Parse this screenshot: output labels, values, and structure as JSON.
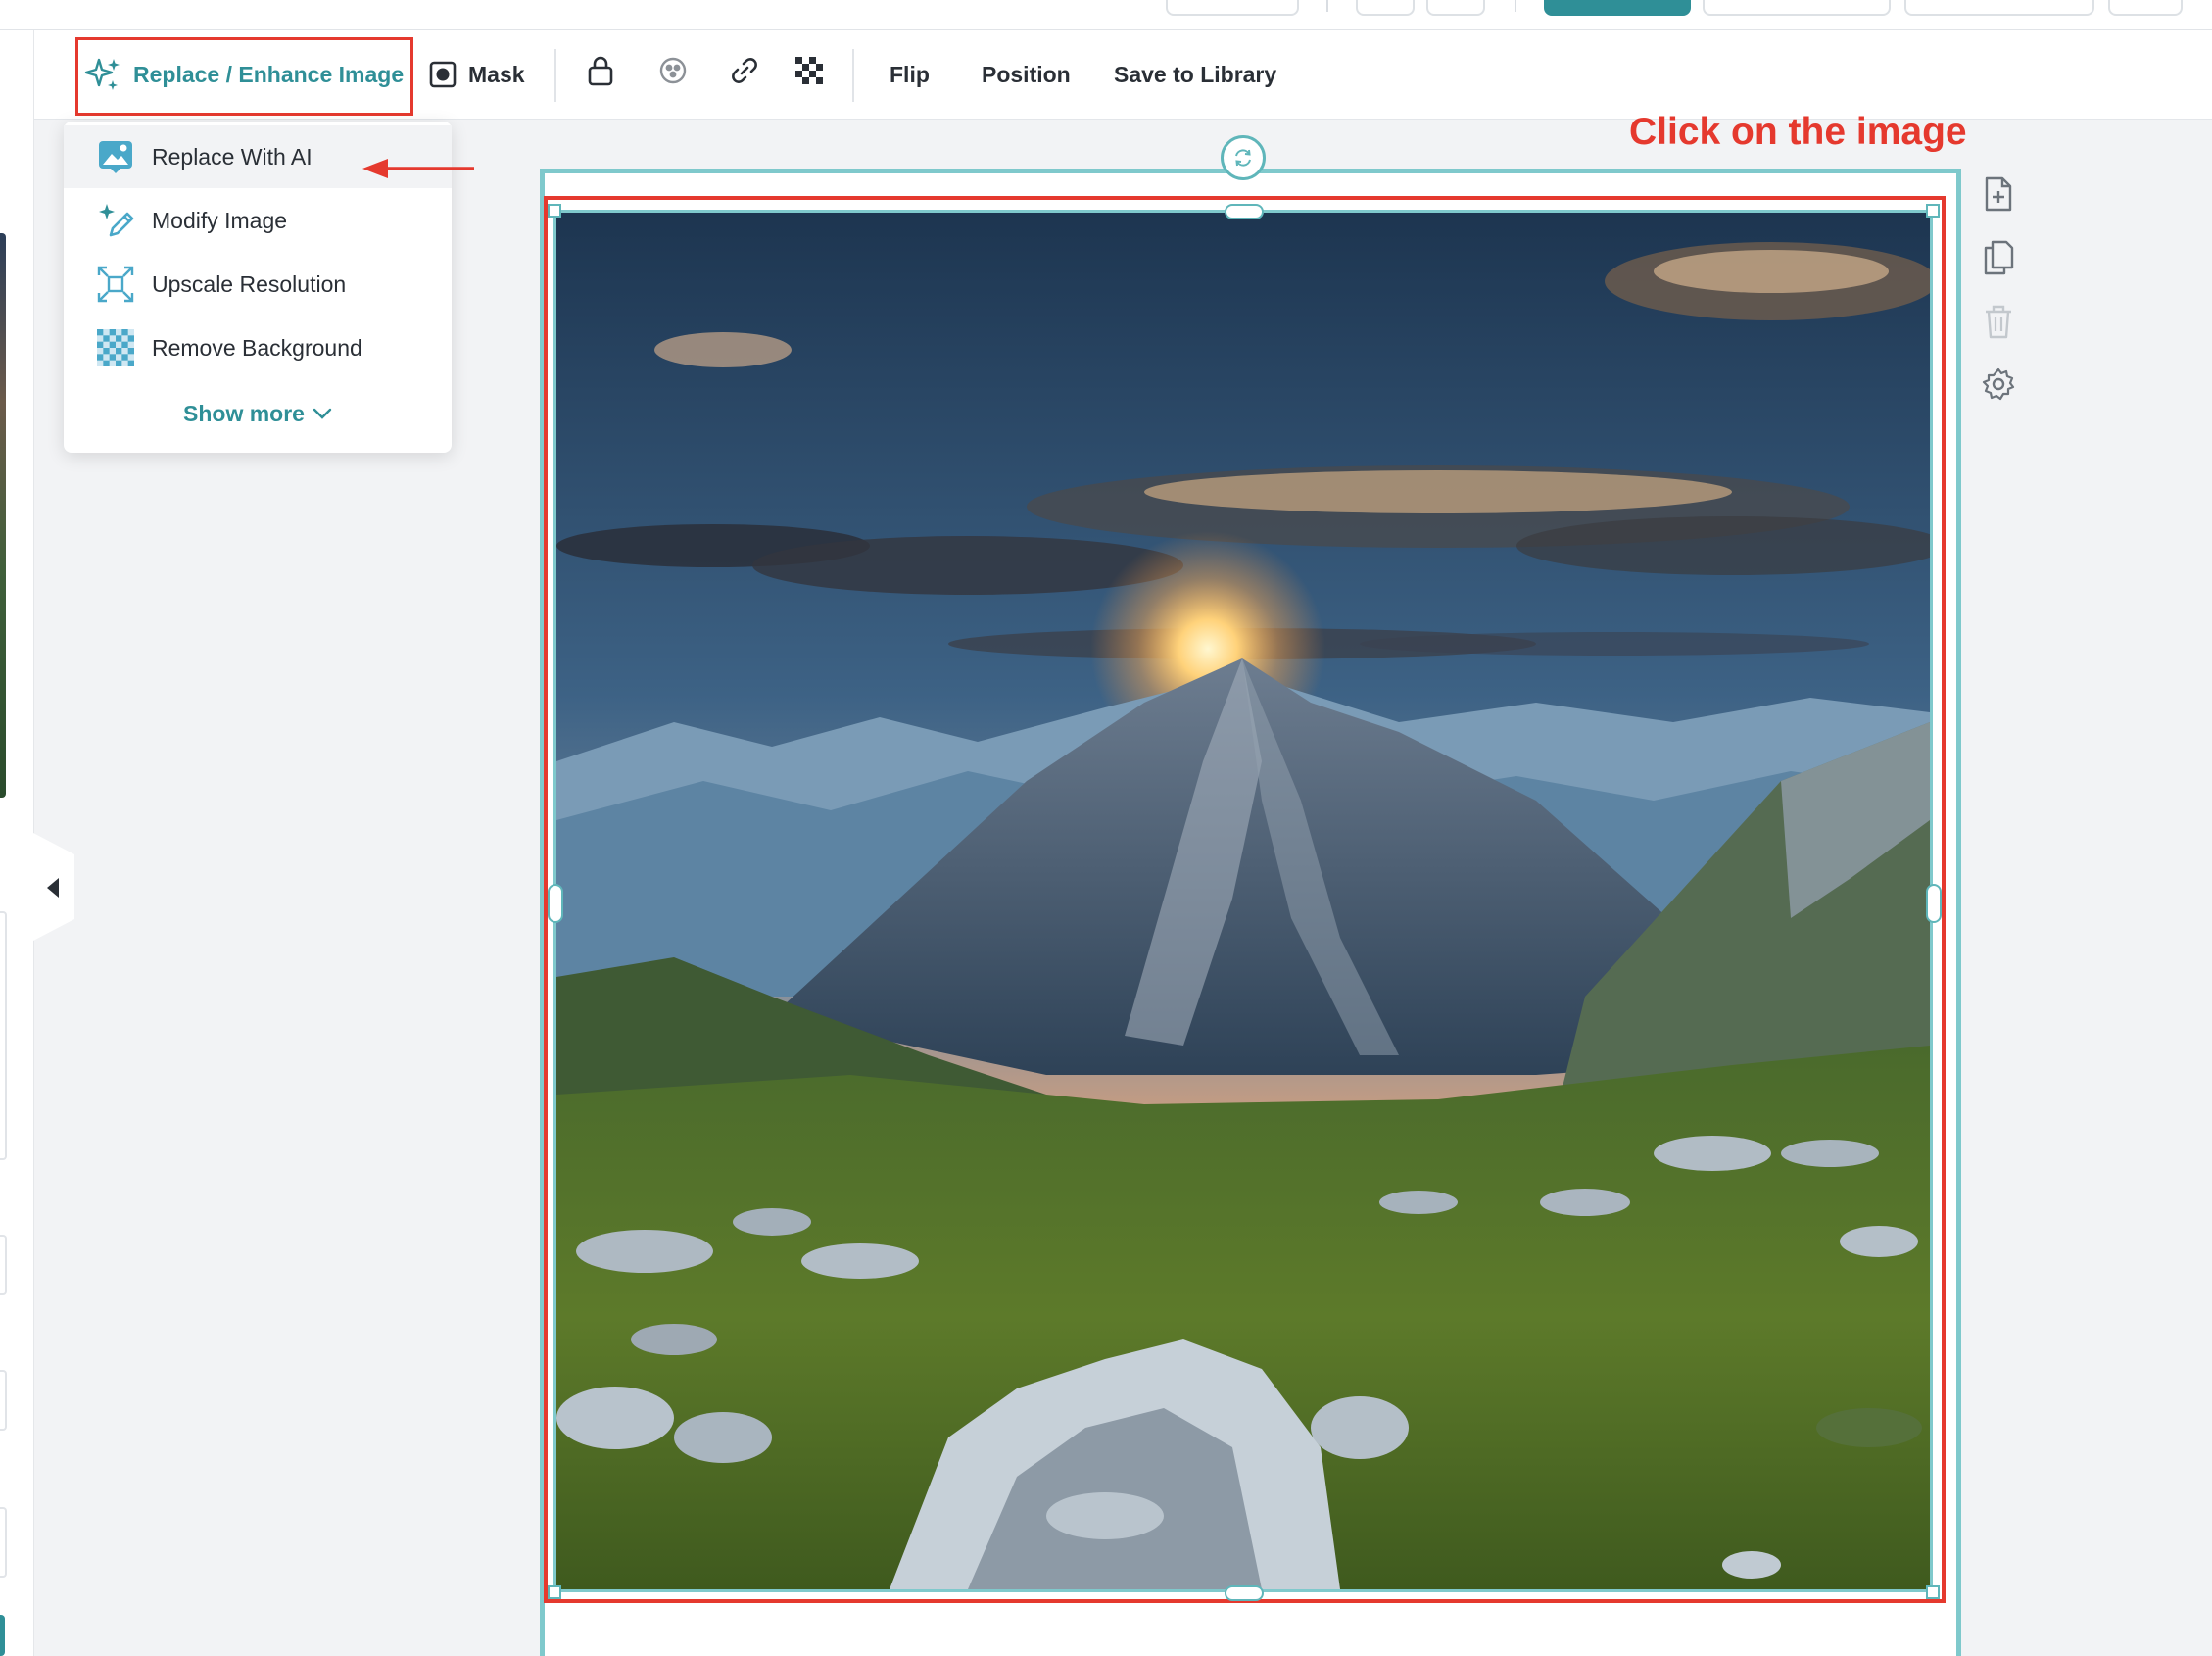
{
  "toolbar": {
    "replace_label": "Replace / Enhance Image",
    "mask_label": "Mask",
    "flip_label": "Flip",
    "position_label": "Position",
    "save_label": "Save to Library"
  },
  "dropdown": {
    "items": [
      {
        "label": "Replace With AI",
        "icon": "image-ai-icon"
      },
      {
        "label": "Modify Image",
        "icon": "magic-pen-icon"
      },
      {
        "label": "Upscale Resolution",
        "icon": "expand-icon"
      },
      {
        "label": "Remove Background",
        "icon": "checker-icon"
      }
    ],
    "show_more": "Show more"
  },
  "annotation": {
    "text": "Click on the image"
  },
  "colors": {
    "accent": "#2f8f97",
    "annotation_red": "#e5392e",
    "selection": "#7fc9cc"
  }
}
